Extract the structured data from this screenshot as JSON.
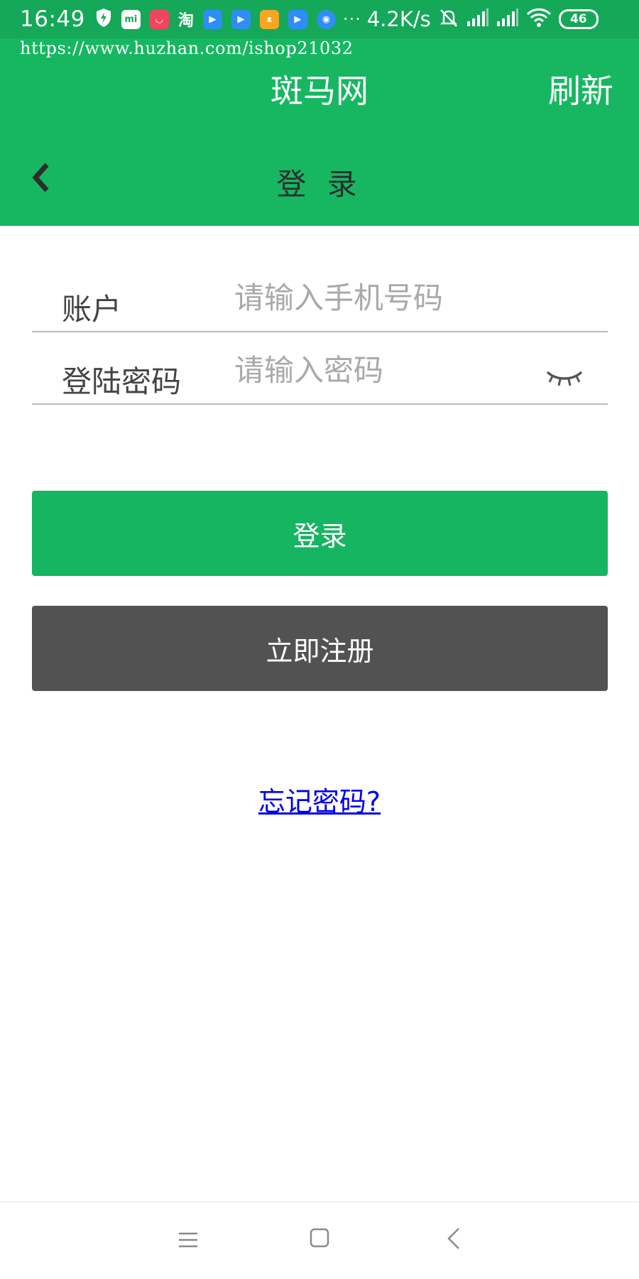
{
  "status_bar": {
    "time": "16:49",
    "notification_icons": [
      "shield-icon",
      "mi-store-icon",
      "shopping-bag-icon",
      "taobao-icon",
      "video-app-icon",
      "video-app-icon",
      "cat-app-icon",
      "video-app-icon",
      "hotspot-icon"
    ],
    "taobao_text": "淘",
    "more": "···",
    "net_speed": "4.2K/s",
    "battery": "46"
  },
  "app_bar": {
    "url": "https://www.huzhan.com/ishop21032",
    "title": "斑马网",
    "refresh_label": "刷新"
  },
  "page": {
    "title": "登 录"
  },
  "form": {
    "account_label": "账户",
    "account_placeholder": "请输入手机号码",
    "password_label": "登陆密码",
    "password_placeholder": "请输入密码"
  },
  "buttons": {
    "login": "登录",
    "register": "立即注册"
  },
  "links": {
    "forgot": "忘记密码?"
  },
  "colors": {
    "brand_green": "#17b762",
    "status_green": "#15a859",
    "register_gray": "#525252",
    "link_blue": "#0000ee"
  }
}
